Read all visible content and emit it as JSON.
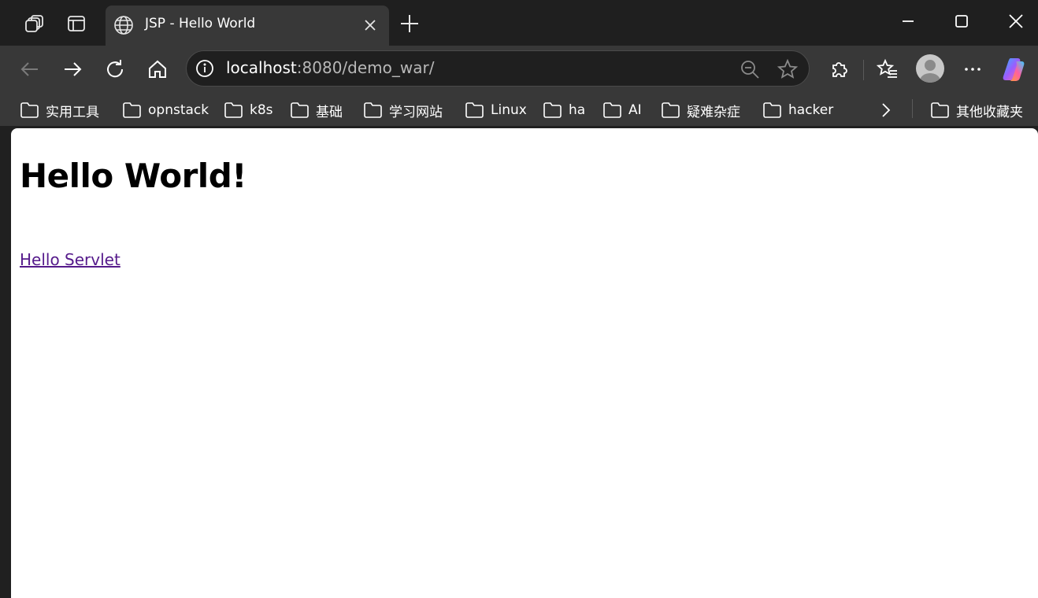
{
  "tab": {
    "title": "JSP - Hello World"
  },
  "address_bar": {
    "host": "localhost",
    "rest": ":8080/demo_war/"
  },
  "bookmarks": [
    {
      "label": "实用工具"
    },
    {
      "label": "opnstack"
    },
    {
      "label": "k8s"
    },
    {
      "label": "基础"
    },
    {
      "label": "学习网站"
    },
    {
      "label": "Linux"
    },
    {
      "label": "ha"
    },
    {
      "label": "AI"
    },
    {
      "label": "疑难杂症"
    },
    {
      "label": "hacker"
    }
  ],
  "other_bookmarks": "其他收藏夹",
  "page": {
    "heading": "Hello World!",
    "link": "Hello Servlet"
  },
  "colors": {
    "titlebar": "#1f1f1f",
    "toolbar": "#383838",
    "link_visited": "#551a8b"
  }
}
